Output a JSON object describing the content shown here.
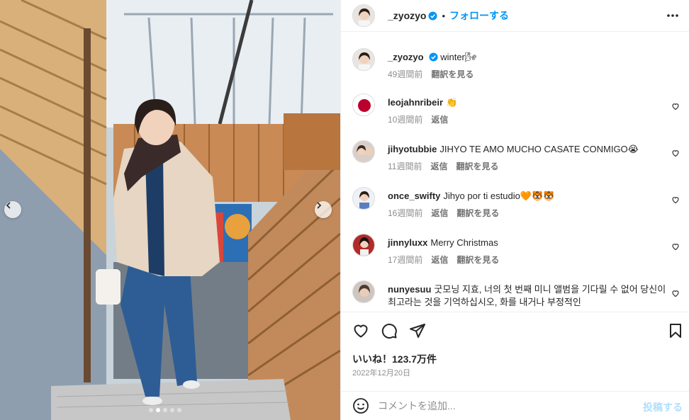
{
  "post": {
    "images_count": 5,
    "active_image": 1
  },
  "header": {
    "username": "_zyozyo",
    "verified": true,
    "separator": "•",
    "follow_label": "フォローする",
    "more_icon": "more-horizontal-icon"
  },
  "caption": {
    "username": "_zyozyo",
    "text": "winter",
    "emoji": "🌬",
    "time": "49週間前",
    "translate": "翻訳を見る"
  },
  "comments": [
    {
      "username": "leojahnribeir",
      "text": "👏",
      "time": "10週間前",
      "reply": "返信",
      "translate": ""
    },
    {
      "username": "jihyotubbie",
      "text": "JIHYO TE AMO MUCHO CASATE CONMIGO😭",
      "time": "11週間前",
      "reply": "返信",
      "translate": "翻訳を見る"
    },
    {
      "username": "once_swifty",
      "text": "Jihyo por ti estudio🧡🐯🐯",
      "time": "16週間前",
      "reply": "返信",
      "translate": "翻訳を見る"
    },
    {
      "username": "jinnyluxx",
      "text": "Merry Christmas",
      "time": "17週間前",
      "reply": "返信",
      "translate": "翻訳を見る"
    },
    {
      "username": "nunyesuu",
      "text": "굿모닝 지효, 너의 첫 번째 미니 앨범을 기다릴 수 없어 당신이 최고라는 것을 기억하십시오, 화를 내거나 부정적인",
      "time": "",
      "reply": "",
      "translate": ""
    }
  ],
  "actions": {
    "like_icon": "heart-icon",
    "comment_icon": "comment-icon",
    "share_icon": "share-icon",
    "save_icon": "bookmark-icon",
    "likes_label": "いいね！123.7万件",
    "date": "2022年12月20日"
  },
  "composer": {
    "emoji_icon": "emoji-icon",
    "placeholder": "コメントを追加...",
    "post_label": "投稿する"
  },
  "colors": {
    "accent": "#0095f6",
    "verified": "#0095f6",
    "post_disabled": "#b2dffc",
    "muted": "#8e8e8e"
  }
}
